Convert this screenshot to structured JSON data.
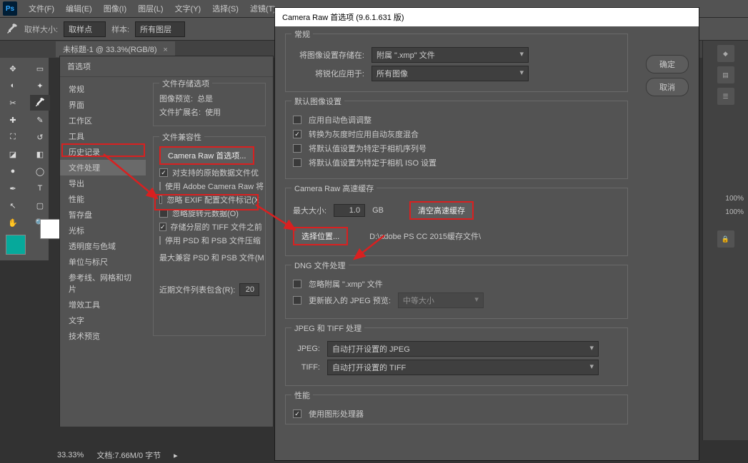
{
  "menubar": {
    "logo": "Ps",
    "items": [
      "文件(F)",
      "编辑(E)",
      "图像(I)",
      "图层(L)",
      "文字(Y)",
      "选择(S)",
      "滤镜(T)"
    ]
  },
  "optionbar": {
    "sample_size_label": "取样大小:",
    "sample_size_value": "取样点",
    "sample_label": "样本:",
    "sample_value": "所有图层"
  },
  "doc_tab": {
    "title": "未标题-1 @ 33.3%(RGB/8)",
    "close": "×"
  },
  "pref": {
    "title": "首选项",
    "cats": [
      "常规",
      "界面",
      "工作区",
      "工具",
      "历史记录",
      "文件处理",
      "导出",
      "性能",
      "暂存盘",
      "光标",
      "透明度与色域",
      "单位与标尺",
      "参考线、网格和切片",
      "增效工具",
      "文字",
      "技术预览"
    ],
    "active_cat": "文件处理",
    "storage_group": "文件存储选项",
    "storage_preview": "图像预览:",
    "storage_preview_v": "总是",
    "storage_ext": "文件扩展名:",
    "storage_ext_v": "使用",
    "compat_group": "文件兼容性",
    "camera_btn": "Camera Raw 首选项...",
    "compat_rows": [
      {
        "checked": true,
        "label": "对支持的原始数据文件优"
      },
      {
        "checked": false,
        "label": "使用 Adobe Camera Raw 将"
      },
      {
        "checked": false,
        "label": "忽略 EXIF 配置文件标记(X"
      },
      {
        "checked": false,
        "label": "忽略旋转元数据(O)"
      },
      {
        "checked": true,
        "label": "存储分层的 TIFF 文件之前"
      },
      {
        "checked": false,
        "label": "停用 PSD 和 PSB 文件压缩"
      }
    ],
    "max_compat": "最大兼容 PSD 和 PSB 文件(M",
    "recent_label": "近期文件列表包含(R):",
    "recent_value": "20"
  },
  "cr": {
    "title": "Camera Raw 首选项  (9.6.1.631 版)",
    "ok": "确定",
    "cancel": "取消",
    "general": {
      "label": "常规",
      "save_label": "将图像设置存储在:",
      "save_value": "附属 \".xmp\" 文件",
      "sharp_label": "将锐化应用于:",
      "sharp_value": "所有图像"
    },
    "defaults": {
      "label": "默认图像设置",
      "rows": [
        {
          "checked": false,
          "label": "应用自动色调调整"
        },
        {
          "checked": true,
          "label": "转换为灰度时应用自动灰度混合"
        },
        {
          "checked": false,
          "label": "将默认值设置为特定于相机序列号"
        },
        {
          "checked": false,
          "label": "将默认值设置为特定于相机 ISO 设置"
        }
      ]
    },
    "cache": {
      "label": "Camera Raw 高速缓存",
      "max_label": "最大大小:",
      "max_value": "1.0",
      "unit": "GB",
      "clear": "清空高速缓存",
      "loc_btn": "选择位置...",
      "loc_path": "D:\\adobe PS CC 2015缓存文件\\"
    },
    "dng": {
      "label": "DNG 文件处理",
      "ignore": {
        "checked": false,
        "label": "忽略附属 \".xmp\" 文件"
      },
      "update": {
        "checked": false,
        "label": "更新嵌入的 JPEG 预览:"
      },
      "update_value": "中等大小"
    },
    "jt": {
      "label": "JPEG 和 TIFF 处理",
      "jpeg_label": "JPEG:",
      "jpeg_value": "自动打开设置的 JPEG",
      "tiff_label": "TIFF:",
      "tiff_value": "自动打开设置的 TIFF"
    },
    "perf": {
      "label": "性能",
      "gpu": {
        "checked": true,
        "label": "使用图形处理器"
      }
    }
  },
  "status": {
    "zoom": "33.33%",
    "doc": "文档:7.66M/0 字节"
  },
  "panels": {
    "pct1": "100%",
    "pct2": "100%"
  }
}
